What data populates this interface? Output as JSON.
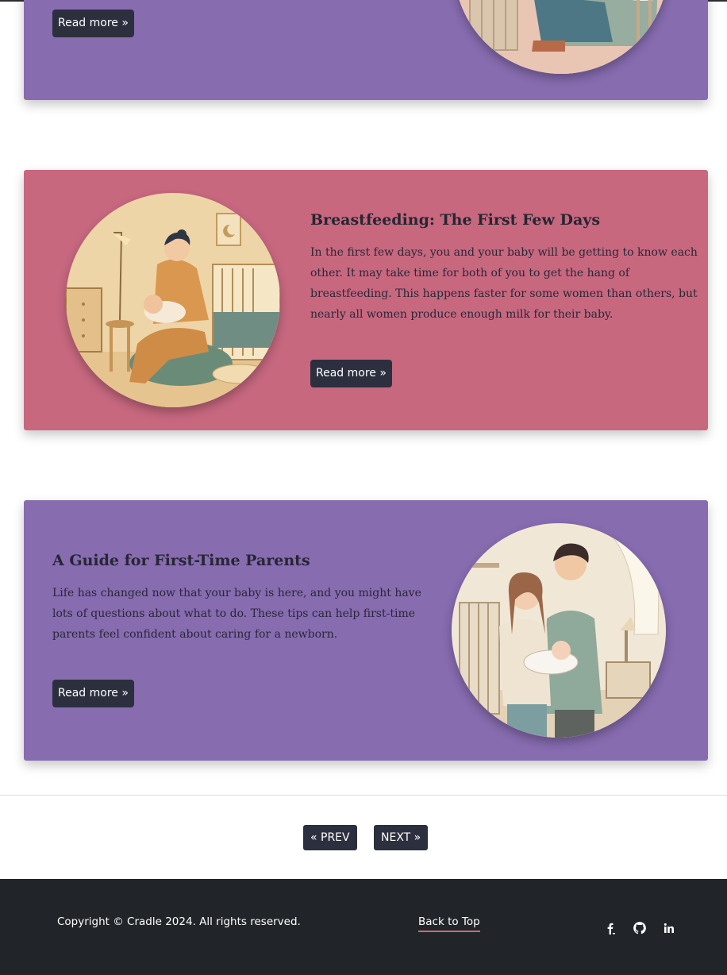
{
  "posts": [
    {
      "read_more": "Read more »"
    },
    {
      "title": "Breastfeeding: The First Few Days",
      "excerpt": "In the first few days, you and your baby will be getting to know each other. It may take time for both of you to get the hang of breastfeeding. This happens faster for some women than others, but nearly all women produce enough milk for their baby.",
      "read_more": "Read more »"
    },
    {
      "title": "A Guide for First-Time Parents",
      "excerpt": "Life has changed now that your baby is here, and you might have lots of questions about what to do. These tips can help first-time parents feel confident about caring for a newborn.",
      "read_more": "Read more »"
    }
  ],
  "pagination": {
    "prev_label": "« PREV",
    "next_label": "NEXT »"
  },
  "footer": {
    "copyright": "Copyright © Cradle 2024. All rights reserved.",
    "back_to_top": "Back to Top",
    "social": [
      "facebook-icon",
      "github-icon",
      "linkedin-icon"
    ]
  },
  "colors": {
    "card_purple": "#876cb0",
    "card_pink": "#c7687f",
    "button_dark": "#2c2f3d",
    "footer_bg": "#212529"
  }
}
